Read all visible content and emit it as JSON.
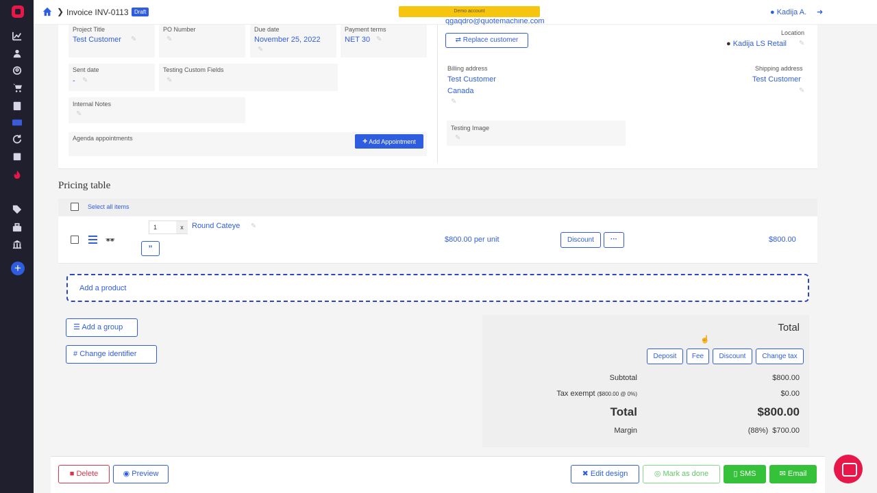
{
  "sidebar": {
    "icons": [
      "chart-icon",
      "users-icon",
      "contacts-icon",
      "cart-icon",
      "clipboard-icon",
      "invoice-icon",
      "refresh-icon",
      "calendar-icon",
      "fire-icon",
      "tags-icon",
      "toolbox-icon",
      "bank-icon"
    ],
    "add_label": "+"
  },
  "header": {
    "invoice_title": "Invoice INV-0113",
    "status_badge": "Draft",
    "demo_banner": "Demo account",
    "user_name": "Kadija A."
  },
  "fields": {
    "project_title_label": "Project Title",
    "project_title_value": "Test Customer",
    "po_number_label": "PO Number",
    "due_date_label": "Due date",
    "due_date_value": "November 25, 2022",
    "payment_terms_label": "Payment terms",
    "payment_terms_value": "NET 30",
    "sent_date_label": "Sent date",
    "sent_date_value": "-",
    "testing_custom_label": "Testing Custom Fields",
    "internal_notes_label": "Internal Notes",
    "agenda_label": "Agenda appointments",
    "add_appointment_label": "Add Appointment"
  },
  "customer": {
    "email_partial": "qgaqdro@quotemachine.com",
    "replace_label": "Replace customer",
    "location_label": "Location",
    "location_value": "Kadija LS Retail",
    "billing_label": "Billing address",
    "billing_line1": "Test Customer",
    "billing_line2": "Canada",
    "shipping_label": "Shipping address",
    "shipping_value": "Test Customer",
    "testing_image_label": "Testing Image"
  },
  "pricing": {
    "title": "Pricing table",
    "select_all": "Select all items",
    "items": [
      {
        "qty": "1",
        "qty_clear": "x",
        "name": "Round Cateye",
        "unit_price": "$800.00 per unit",
        "discount_label": "Discount",
        "more_label": "···",
        "total": "$800.00"
      }
    ],
    "add_product": "Add a product",
    "add_group": "Add a group",
    "change_identifier": "Change identifier"
  },
  "totals": {
    "heading": "Total",
    "deposit": "Deposit",
    "fee": "Fee",
    "discount": "Discount",
    "change_tax": "Change tax",
    "subtotal_label": "Subtotal",
    "subtotal_value": "$800.00",
    "tax_label": "Tax exempt",
    "tax_note": "($800.00 @ 0%)",
    "tax_value": "$0.00",
    "total_label": "Total",
    "total_value": "$800.00",
    "margin_label": "Margin",
    "margin_pct": "(88%)",
    "margin_value": "$700.00"
  },
  "actions": {
    "delete": "Delete",
    "preview": "Preview",
    "edit_design": "Edit design",
    "mark_done": "Mark as done",
    "sms": "SMS",
    "email": "Email"
  },
  "colors": {
    "primary": "#2f5de0",
    "sidebar": "#1f1f2e",
    "danger": "#d9364b",
    "success": "#35c23a",
    "brand": "#e8174a"
  }
}
